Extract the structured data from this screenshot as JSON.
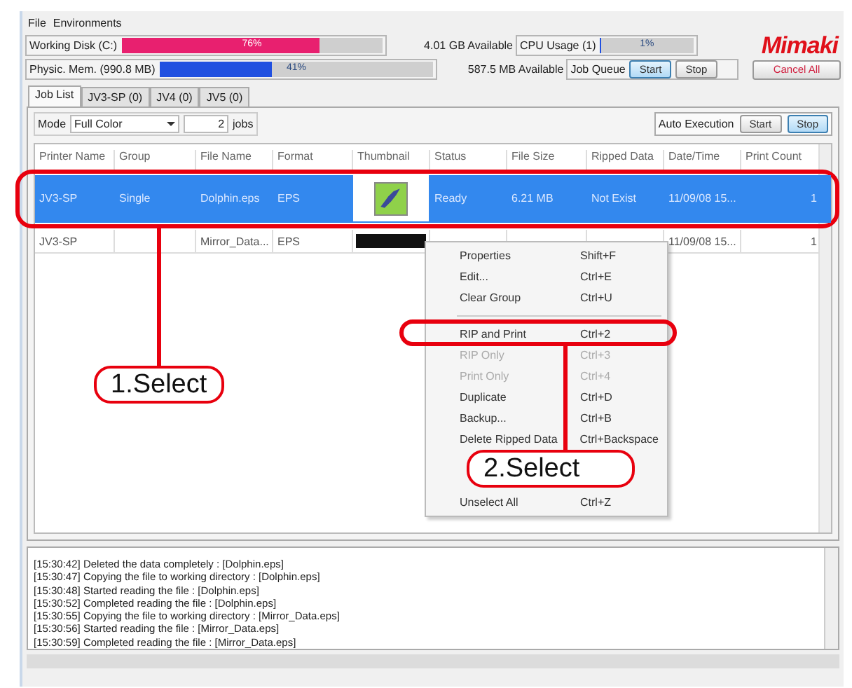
{
  "menu_bar": [
    "File",
    "Environments"
  ],
  "working_disk": {
    "label": "Working Disk (C:)",
    "level": 0.76,
    "reading": "76%",
    "available": "4.01 GB Available"
  },
  "cpu": {
    "label": "CPU Usage (1)",
    "level": 0.01,
    "reading": "1%"
  },
  "logo": "Mimaki",
  "memory": {
    "label": "Physic. Mem. (990.8 MB)",
    "level": 0.41,
    "reading": "41%",
    "available": "587.5 MB Available"
  },
  "job_queue": {
    "label": "Job Queue",
    "buttons": [
      {
        "label": "Start",
        "selected": true
      },
      {
        "label": "Stop",
        "selected": false
      }
    ]
  },
  "cancel_all": "Cancel All",
  "tabs": [
    {
      "label": "Job List",
      "selected": true
    },
    {
      "label": "JV3-SP (0)",
      "selected": false
    },
    {
      "label": "JV4 (0)",
      "selected": false
    },
    {
      "label": "JV5 (0)",
      "selected": false
    }
  ],
  "mode": {
    "label": "Mode",
    "value": "Full Color",
    "count": "2",
    "unit": "jobs"
  },
  "auto_execution": {
    "label": "Auto Execution",
    "buttons": [
      {
        "label": "Start",
        "selected": false
      },
      {
        "label": "Stop",
        "selected": true
      }
    ]
  },
  "table": {
    "columns": [
      {
        "label": "Printer Name",
        "kind": "text"
      },
      {
        "label": "Group",
        "kind": "text"
      },
      {
        "label": "File Name",
        "kind": "text"
      },
      {
        "label": "Format",
        "kind": "text"
      },
      {
        "label": "Thumbnail",
        "kind": "image"
      },
      {
        "label": "Status",
        "kind": "text"
      },
      {
        "label": "File Size",
        "kind": "text"
      },
      {
        "label": "Ripped Data",
        "kind": "text"
      },
      {
        "label": "Date/Time",
        "kind": "text"
      },
      {
        "label": "Print Count",
        "kind": "number"
      }
    ],
    "rows": [
      {
        "selected": true,
        "kind": "bird",
        "cells": [
          "JV3-SP",
          "Single",
          "Dolphin.eps",
          "EPS",
          null,
          "Ready",
          "6.21 MB",
          "Not Exist",
          "11/09/08 15...",
          "1"
        ]
      },
      {
        "selected": false,
        "kind": "lettering",
        "cells": [
          "JV3-SP",
          null,
          "Mirror_Data...",
          "EPS",
          null,
          null,
          null,
          null,
          "11/09/08 15...",
          "1"
        ]
      }
    ]
  },
  "context_menu": [
    {
      "kind": "item",
      "label": "Properties",
      "shortcut": "Shift+F",
      "disabled": false
    },
    {
      "kind": "item",
      "label": "Edit...",
      "shortcut": "Ctrl+E",
      "disabled": false
    },
    {
      "kind": "item",
      "label": "Clear Group",
      "shortcut": "Ctrl+U",
      "disabled": false
    },
    {
      "kind": "separator"
    },
    {
      "kind": "item",
      "label": "RIP and Print",
      "shortcut": "Ctrl+2",
      "disabled": false
    },
    {
      "kind": "item",
      "label": "RIP Only",
      "shortcut": "Ctrl+3",
      "disabled": true
    },
    {
      "kind": "item",
      "label": "Print Only",
      "shortcut": "Ctrl+4",
      "disabled": true
    },
    {
      "kind": "item",
      "label": "Duplicate",
      "shortcut": "Ctrl+D",
      "disabled": false
    },
    {
      "kind": "item",
      "label": "Backup...",
      "shortcut": "Ctrl+B",
      "disabled": false
    },
    {
      "kind": "item",
      "label": "Delete Ripped Data",
      "shortcut": "Ctrl+Backspace",
      "disabled": false
    },
    {
      "kind": "covered"
    },
    {
      "kind": "item",
      "label": "Unselect All",
      "shortcut": "Ctrl+Z",
      "disabled": false
    }
  ],
  "log": [
    "[15:30:42] Deleted the data completely : [Dolphin.eps]",
    "[15:30:47] Copying the file to working directory : [Dolphin.eps]",
    "[15:30:48] Started reading the file : [Dolphin.eps]",
    "[15:30:52] Completed reading the file : [Dolphin.eps]",
    "[15:30:55] Copying the file to working directory : [Mirror_Data.eps]",
    "[15:30:56] Started reading the file : [Mirror_Data.eps]",
    "[15:30:59] Completed reading the file : [Mirror_Data.eps]"
  ],
  "annotations": [
    {
      "label": "1.Select"
    },
    {
      "label": "2.Select"
    }
  ]
}
